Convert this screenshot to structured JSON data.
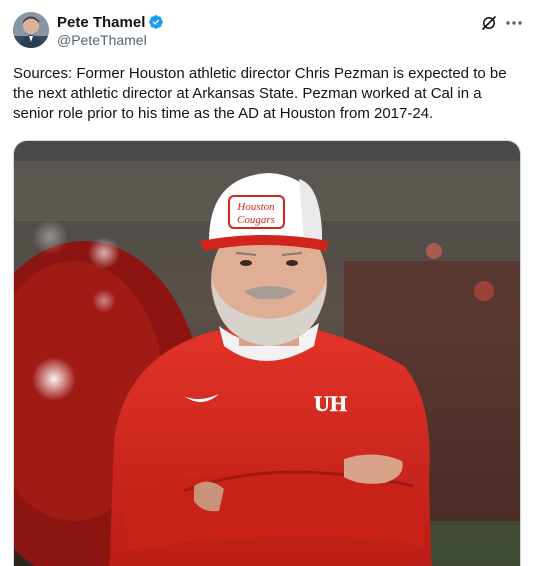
{
  "author": {
    "display_name": "Pete Thamel",
    "handle": "@PeteThamel",
    "verified_icon": "verified-badge-icon",
    "badge_color": "#1d9bf0"
  },
  "actions": {
    "grok_icon": "grok-icon",
    "more_icon": "more-dots-icon"
  },
  "tweet": {
    "text": "Sources: Former Houston athletic director Chris Pezman is expected to be the next athletic director at Arkansas State. Pezman worked at Cal in a senior role prior to his time as the AD at Houston from 2017-24."
  },
  "media": {
    "description_icon": "photo",
    "hat_text_line1": "Houston",
    "hat_text_line2": "Cougars",
    "logo_text": "UH",
    "accent_color": "#e2231a"
  }
}
